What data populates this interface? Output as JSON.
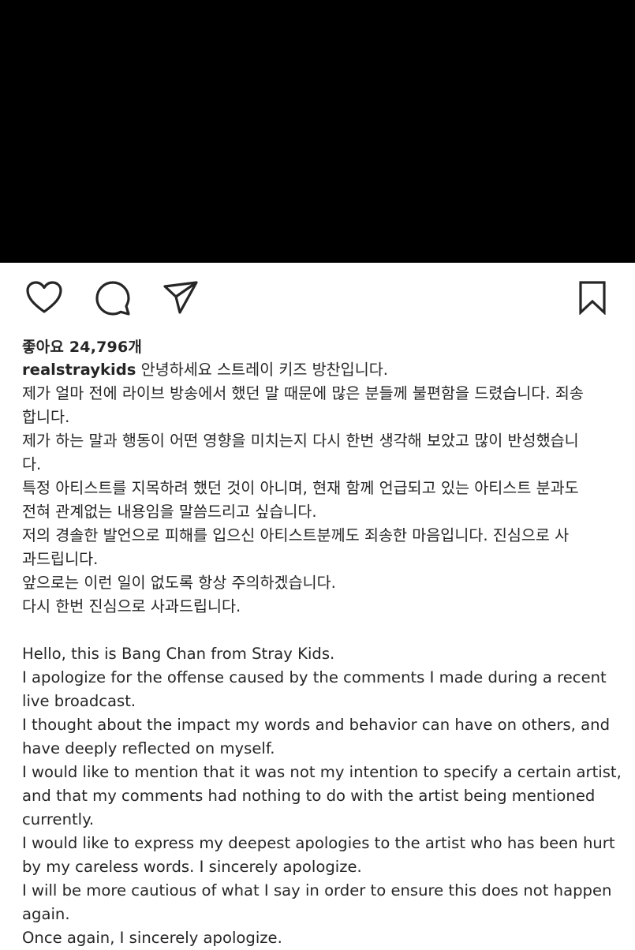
{
  "post": {
    "like_count_label": "좋아요 24,796개",
    "username": "realstraykids",
    "caption_lines": [
      "안녕하세요 스트레이 키즈 방찬입니다.",
      "제가 얼마 전에 라이브 방송에서 했던 말 때문에 많은 분들께 불편함을 드렸습니다. 죄송",
      "합니다.",
      "제가 하는 말과 행동이 어떤 영향을 미치는지 다시 한번 생각해 보았고 많이 반성했습니",
      "다.",
      "특정 아티스트를 지목하려 했던 것이 아니며, 현재 함께 언급되고 있는 아티스트 분과도",
      "전혀 관계없는 내용임을 말씀드리고 싶습니다.",
      "저의 경솔한 발언으로 피해를 입으신 아티스트분께도 죄송한 마음입니다. 진심으로 사",
      "과드립니다.",
      "앞으로는 이런 일이 없도록 항상 주의하겠습니다.",
      "다시 한번 진심으로 사과드립니다.",
      "",
      "Hello, this is Bang Chan from Stray Kids.",
      "I apologize for the offense caused by the comments I made during a recent",
      "live broadcast.",
      "I thought about the impact my words and behavior can have on others, and",
      "have deeply reflected on myself.",
      "I would like to mention that it was not my intention to specify a certain artist,",
      "and that my comments had nothing to do with the artist being mentioned",
      "currently.",
      "I would like to express my deepest apologies to the artist who has been hurt",
      "by my careless words. I sincerely apologize.",
      "I will be more cautious of what I say in order to ensure this does not happen",
      "again.",
      "Once again, I sincerely apologize."
    ]
  },
  "icons": {
    "like": "heart-icon",
    "comment": "comment-bubble-icon",
    "share": "paper-plane-icon",
    "save": "bookmark-icon"
  },
  "colors": {
    "media_background": "#000000",
    "text": "#262626"
  }
}
